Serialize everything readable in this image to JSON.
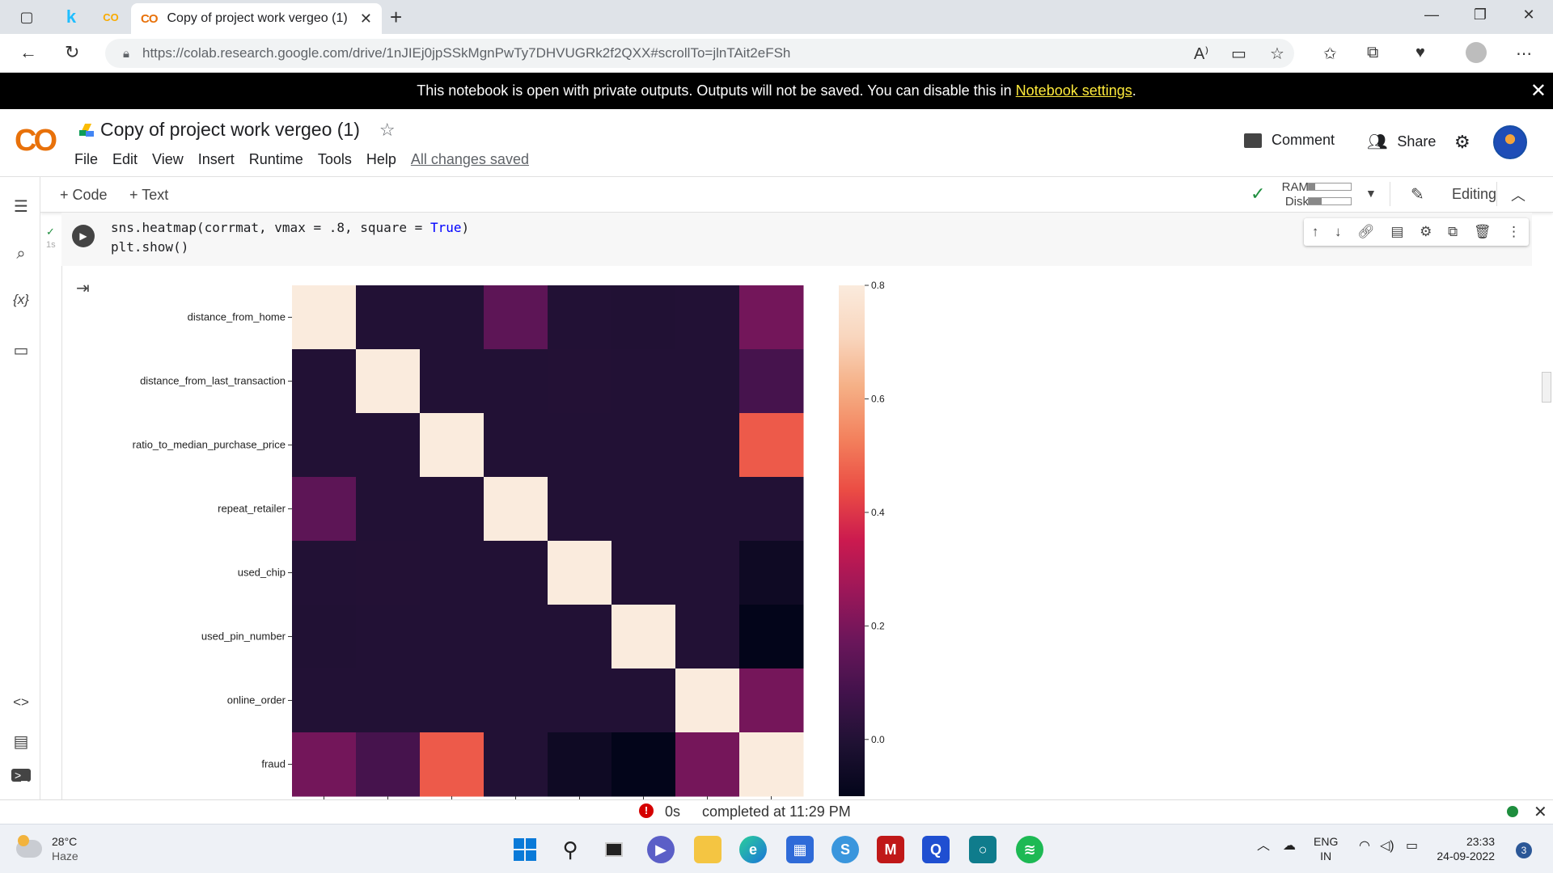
{
  "browser": {
    "tab_title": "Copy of project work vergeo (1)",
    "tab_logo": "CO",
    "url": "https://colab.research.google.com/drive/1nJIEj0jpSSkMgnPwTy7DHVUGRk2f2QXX#scrollTo=jlnTAit2eFSh"
  },
  "banner": {
    "text": "This notebook is open with private outputs. Outputs will not be saved. You can disable this in",
    "link": "Notebook settings",
    "suffix": "."
  },
  "notebook": {
    "logo": "CO",
    "title": "Copy of project work vergeo (1)",
    "menu": [
      "File",
      "Edit",
      "View",
      "Insert",
      "Runtime",
      "Tools",
      "Help"
    ],
    "save_status": "All changes saved",
    "comment": "Comment",
    "share": "Share"
  },
  "toolbar": {
    "add_code": "+ Code",
    "add_text": "+ Text",
    "ram_label": "RAM",
    "disk_label": "Disk",
    "ram_fill": 0.15,
    "disk_fill": 0.3,
    "editing": "Editing"
  },
  "cell": {
    "exec_time": "1s",
    "code_line1_a": "sns.heatmap(corrmat, vmax = .8, square = ",
    "code_line1_kw": "True",
    "code_line1_b": ")",
    "code_line2": "plt.show()"
  },
  "chart_data": {
    "type": "heatmap",
    "title": "",
    "labels": [
      "distance_from_home",
      "distance_from_last_transaction",
      "ratio_to_median_purchase_price",
      "repeat_retailer",
      "used_chip",
      "used_pin_number",
      "online_order",
      "fraud"
    ],
    "matrix": [
      [
        1.0,
        0.0,
        -0.001,
        0.143,
        -0.001,
        -0.002,
        -0.001,
        0.188
      ],
      [
        0.0,
        1.0,
        0.001,
        -0.001,
        0.002,
        -0.001,
        -0.0,
        0.092
      ],
      [
        -0.001,
        0.001,
        1.0,
        0.001,
        0.001,
        0.0,
        -0.001,
        0.462
      ],
      [
        0.143,
        -0.001,
        0.001,
        1.0,
        -0.001,
        -0.0,
        -0.001,
        -0.001
      ],
      [
        -0.001,
        0.002,
        0.001,
        -0.001,
        1.0,
        -0.001,
        -0.0,
        -0.061
      ],
      [
        -0.002,
        -0.001,
        0.0,
        -0.0,
        -0.001,
        1.0,
        -0.0,
        -0.1
      ],
      [
        -0.001,
        -0.0,
        -0.001,
        -0.001,
        -0.0,
        -0.0,
        1.0,
        0.192
      ],
      [
        0.188,
        0.092,
        0.462,
        -0.001,
        -0.061,
        -0.1,
        0.192,
        1.0
      ]
    ],
    "vmax": 0.8,
    "vmin": -0.1,
    "colormap": "rocket",
    "colorbar_ticks": [
      "0.0",
      "0.2",
      "0.4",
      "0.6",
      "0.8"
    ]
  },
  "statusbar": {
    "error_icon": "!",
    "elapsed": "0s",
    "completed": "completed at 11:29 PM"
  },
  "taskbar": {
    "temperature": "28°C",
    "weather": "Haze",
    "lang": "ENG",
    "region": "IN",
    "time": "23:33",
    "date": "24-09-2022",
    "notifications": "3"
  }
}
